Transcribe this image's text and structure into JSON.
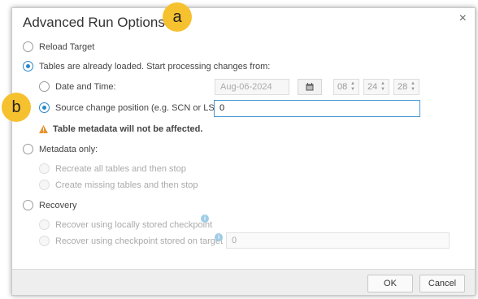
{
  "dialog": {
    "title": "Advanced Run Options"
  },
  "options": {
    "reload_target": "Reload Target",
    "tables_loaded": "Tables are already loaded. Start processing changes from:",
    "date_and_time": "Date and Time:",
    "source_change_position": "Source change position (e.g. SCN or LSN):",
    "warning": "Table metadata will not be affected.",
    "metadata_only": "Metadata only:",
    "recreate_all": "Recreate all tables and then stop",
    "create_missing": "Create missing tables and then stop",
    "recovery": "Recovery",
    "recover_local": "Recover using locally stored checkpoint",
    "recover_target": "Recover using checkpoint stored on target"
  },
  "fields": {
    "date": "Aug-06-2024",
    "hour": "08",
    "minute": "24",
    "second": "28",
    "scn_value": "0",
    "checkpoint_value": "0"
  },
  "buttons": {
    "ok": "OK",
    "cancel": "Cancel"
  },
  "callouts": {
    "a": "a",
    "b": "b"
  },
  "icons": {
    "close": "close-icon",
    "calendar": "calendar-icon",
    "warning": "warning-icon",
    "info": "info-icon"
  },
  "colors": {
    "accent": "#2a87c9",
    "callout": "#f6c12f",
    "warning": "#e8922d"
  }
}
